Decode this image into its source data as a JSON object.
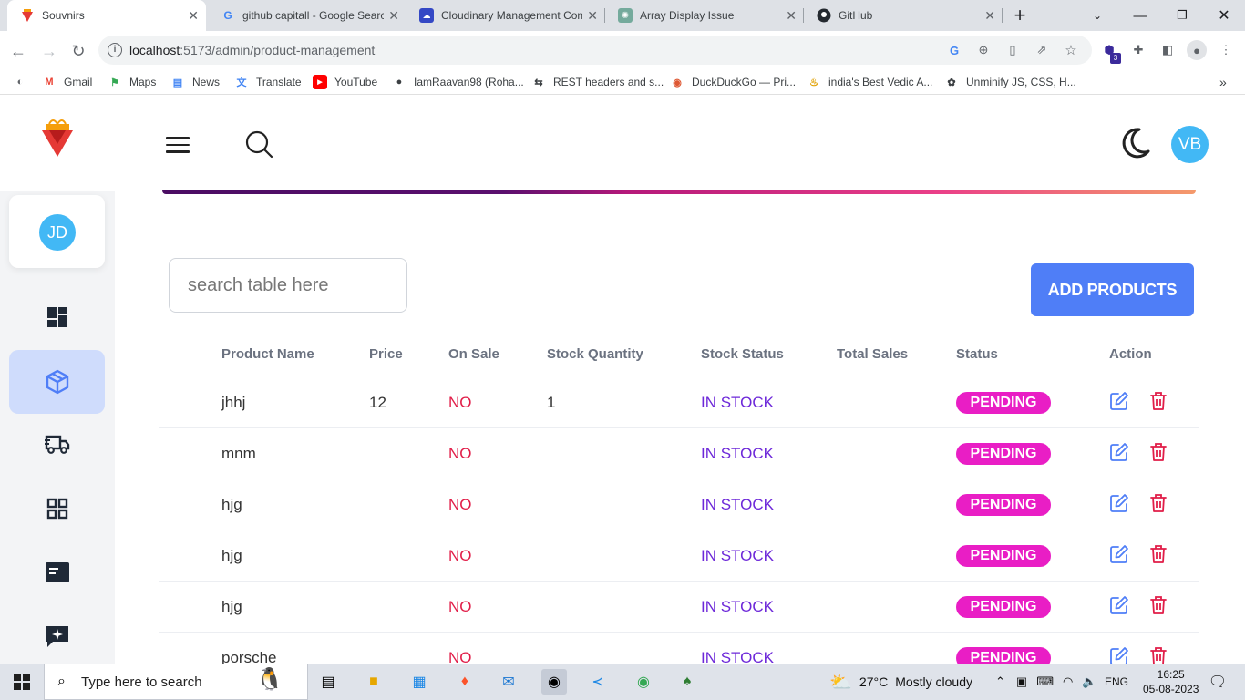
{
  "browser": {
    "tabs": [
      {
        "label": "Souvnirs",
        "active": true
      },
      {
        "label": "github capitall - Google Search",
        "active": false
      },
      {
        "label": "Cloudinary Management Con",
        "active": false
      },
      {
        "label": "Array Display Issue",
        "active": false
      },
      {
        "label": "GitHub",
        "active": false
      }
    ],
    "new_tab": "+",
    "url_host": "localhost",
    "url_path": ":5173/admin/product-management",
    "bookmarks": [
      "Gmail",
      "Maps",
      "News",
      "Translate",
      "YouTube",
      "IamRaavan98 (Roha...",
      "REST headers and s...",
      "DuckDuckGo — Pri...",
      "india's Best Vedic A...",
      "Unminify JS, CSS, H..."
    ],
    "extension_badge": "3"
  },
  "header": {
    "user_initials": "VB"
  },
  "sidebar": {
    "profile_initials": "JD",
    "items": [
      "dashboard-icon",
      "products-icon",
      "shipping-icon",
      "categories-icon",
      "pages-icon",
      "reviews-icon"
    ]
  },
  "toolbar": {
    "search_placeholder": "search table here",
    "add_label": "ADD PRODUCTS"
  },
  "table": {
    "columns": [
      "Product Name",
      "Price",
      "On Sale",
      "Stock Quantity",
      "Stock Status",
      "Total Sales",
      "Status",
      "Action"
    ],
    "rows": [
      {
        "name": "jhhj",
        "price": "12",
        "on_sale": "NO",
        "qty": "1",
        "stock_status": "IN STOCK",
        "total_sales": "",
        "status": "PENDING"
      },
      {
        "name": "mnm",
        "price": "",
        "on_sale": "NO",
        "qty": "",
        "stock_status": "IN STOCK",
        "total_sales": "",
        "status": "PENDING"
      },
      {
        "name": "hjg",
        "price": "",
        "on_sale": "NO",
        "qty": "",
        "stock_status": "IN STOCK",
        "total_sales": "",
        "status": "PENDING"
      },
      {
        "name": "hjg",
        "price": "",
        "on_sale": "NO",
        "qty": "",
        "stock_status": "IN STOCK",
        "total_sales": "",
        "status": "PENDING"
      },
      {
        "name": "hjg",
        "price": "",
        "on_sale": "NO",
        "qty": "",
        "stock_status": "IN STOCK",
        "total_sales": "",
        "status": "PENDING"
      },
      {
        "name": "porsche",
        "price": "",
        "on_sale": "NO",
        "qty": "",
        "stock_status": "IN STOCK",
        "total_sales": "",
        "status": "PENDING"
      }
    ]
  },
  "taskbar": {
    "search_placeholder": "Type here to search",
    "weather_temp": "27°C",
    "weather_text": "Mostly cloudy",
    "language": "ENG",
    "time": "16:25",
    "date": "05-08-2023"
  },
  "colors": {
    "accent": "#4f7ef7",
    "pending": "#e91ec5",
    "no": "#e11d48",
    "in_stock": "#6d28d9",
    "avatar": "#42b8f5"
  }
}
